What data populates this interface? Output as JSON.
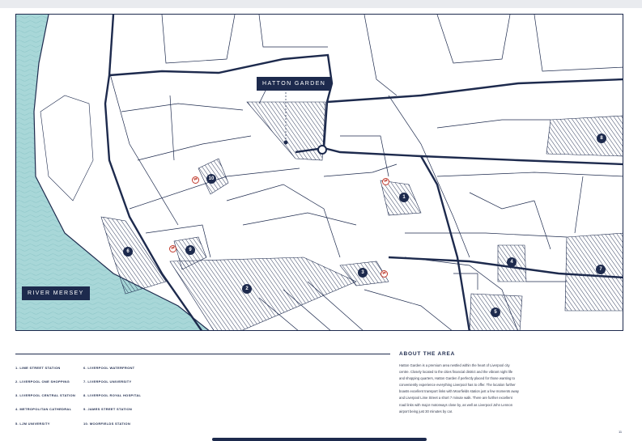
{
  "map": {
    "colors": {
      "water": "#a8d7d8",
      "road": "#1d2a4d",
      "label_bg": "#1d2a4d"
    },
    "labels": {
      "hatton_garden": "HATTON GARDEN",
      "river_mersey": "RIVER MERSEY"
    },
    "markers": [
      "1",
      "2",
      "3",
      "4",
      "5",
      "6",
      "7",
      "8",
      "9",
      "10"
    ],
    "rail_icon": "rail-station-icon"
  },
  "legend": {
    "items": [
      "1. LIME STREET STATION",
      "2. LIVERPOOL ONE SHOPPING",
      "3. LIVERPOOL CENTRAL STATION",
      "4. METROPOLITAN CATHEDRAL",
      "5. LJM UNIVERSITY",
      "6. LIVERPOOL WATERFRONT",
      "7. LIVERPOOL UNIVERSITY",
      "8. LIVERPOOL ROYAL HOSPITAL",
      "9. JAMES STREET STATION",
      "10. MOORFIELDS STATION"
    ]
  },
  "about": {
    "title": "ABOUT THE AREA",
    "lines": [
      "Hatton Garden is a premium area nestled within the heart of Liverpool city",
      "centre. Closely located to the cities financial district and the vibrant night life",
      "and shopping quarters, Hatton Garden if perfectly placed for those wanting to",
      "conveniently experience everything Liverpool has to offer. The location further",
      "boasts excellent transport links with Moorfields station just a few moments away",
      "and Liverpool Lime Street a short 7 minute walk. There are further excellent",
      "road links with major motorways close by, as well as Liverpool John Lennon",
      "airport being just 30 minutes by car."
    ]
  },
  "page_number": "11"
}
